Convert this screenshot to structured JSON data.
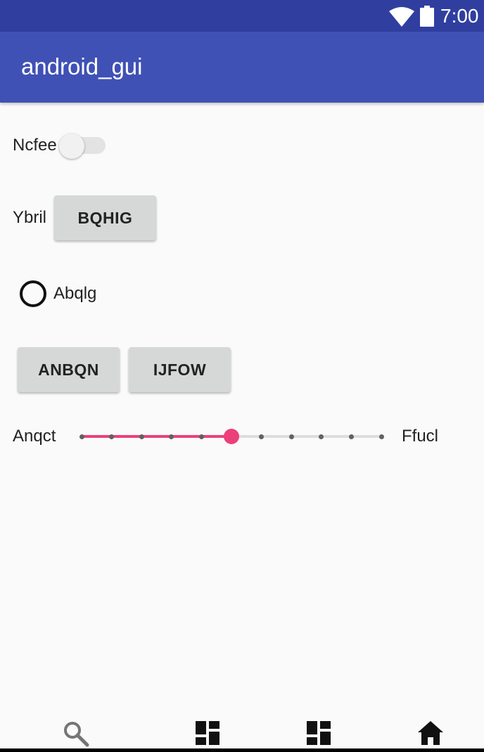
{
  "status_bar": {
    "time": "7:00",
    "icons": [
      "wifi-icon",
      "battery-icon"
    ],
    "color": "#303f9f"
  },
  "app_bar": {
    "title": "android_gui",
    "color": "#3f51b5"
  },
  "switch_row": {
    "label": "Ncfee",
    "checked": false
  },
  "button_row": {
    "label": "Ybril",
    "button": "BQHIG"
  },
  "radio": {
    "label": "Abqlg",
    "checked": false
  },
  "buttons": [
    "ANBQN",
    "IJFOW"
  ],
  "slider": {
    "left_label": "Anqct",
    "right_label": "Ffucl",
    "ticks": 11,
    "value_index": 5,
    "accent": "#ec407a"
  },
  "bottom_nav": {
    "items": [
      "search-icon",
      "dashboard-icon",
      "dashboard-icon",
      "home-icon"
    ]
  }
}
